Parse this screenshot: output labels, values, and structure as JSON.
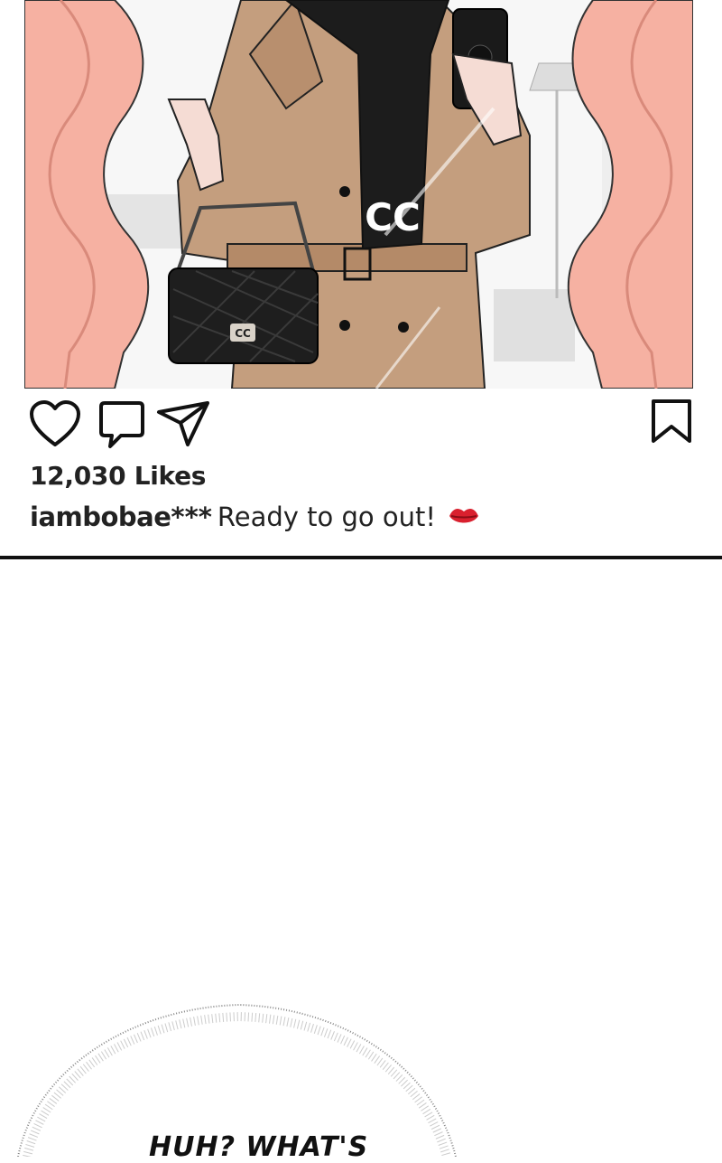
{
  "post": {
    "likes": "12,030 Likes",
    "username": "iambobae",
    "username_suffix": "***",
    "caption": "Ready to go out!",
    "caption_emoji": "lips-icon"
  },
  "actions": {
    "like_icon": "heart-icon",
    "comment_icon": "comment-icon",
    "share_icon": "send-icon",
    "save_icon": "bookmark-icon"
  },
  "bag_logo": "CC",
  "scarf_logo": "CC",
  "speech": {
    "text": "HUH? WHAT'S"
  },
  "colors": {
    "coat": "#c49e7e",
    "scarf": "#1c1c1c",
    "wavy_frame": "#f6b1a2",
    "divider": "#111111"
  }
}
